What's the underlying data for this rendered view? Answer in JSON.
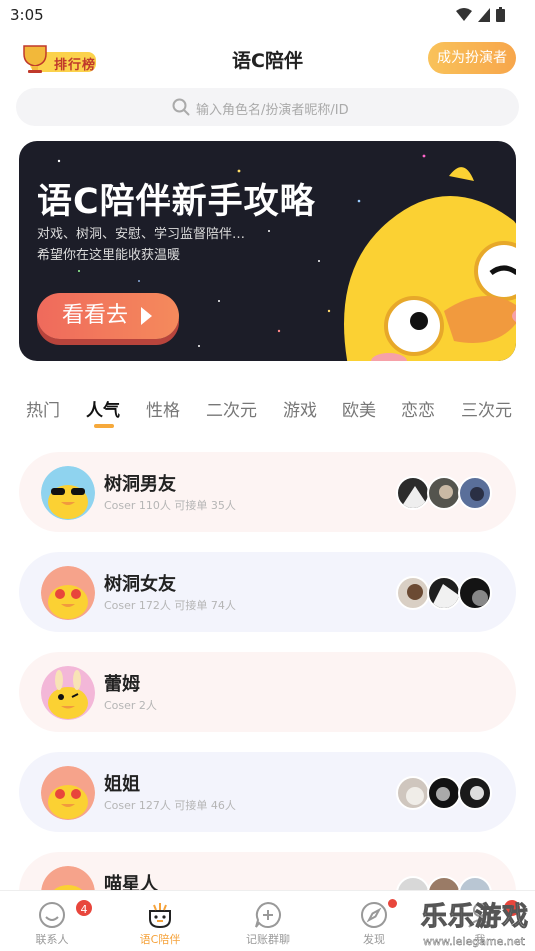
{
  "status_bar": {
    "time": "3:05"
  },
  "header": {
    "rank_label": "排行榜",
    "title": "语C陪伴",
    "become_button": "成为扮演者"
  },
  "search": {
    "placeholder": "输入角色名/扮演者昵称/ID"
  },
  "banner": {
    "title": "语C陪伴新手攻略",
    "subtitle_line1": "对戏、树洞、安慰、学习监督陪伴…",
    "subtitle_line2": "希望你在这里能收获温暖",
    "button_label": "看看去"
  },
  "tabs": [
    {
      "label": "热门"
    },
    {
      "label": "人气"
    },
    {
      "label": "性格"
    },
    {
      "label": "二次元"
    },
    {
      "label": "游戏"
    },
    {
      "label": "欧美"
    },
    {
      "label": "恋恋"
    },
    {
      "label": "三次元"
    }
  ],
  "active_tab": "人气",
  "cards": [
    {
      "title": "树洞男友",
      "meta": "Coser 110人  可接单 35人"
    },
    {
      "title": "树洞女友",
      "meta": "Coser 172人  可接单 74人"
    },
    {
      "title": "蕾姆",
      "meta": "Coser 2人"
    },
    {
      "title": "姐姐",
      "meta": "Coser 127人  可接单 46人"
    },
    {
      "title": "喵星人",
      "meta": ""
    }
  ],
  "bottom_nav": [
    {
      "label": "联系人",
      "icon": "smile-icon",
      "badge": "4"
    },
    {
      "label": "语C陪伴",
      "icon": "duck-icon",
      "badge": ""
    },
    {
      "label": "记账群聊",
      "icon": "chat-plus-icon",
      "badge": ""
    },
    {
      "label": "发现",
      "icon": "compass-icon",
      "badge": ""
    },
    {
      "label": "我",
      "icon": "person-icon",
      "badge": "1"
    }
  ],
  "watermark": {
    "text": "乐乐游戏",
    "url": "www.lelegame.net"
  },
  "colors": {
    "accent": "#f5a23a",
    "badge": "#e8463c",
    "card_pink": "#fdf4f3",
    "card_blue": "#f3f4fc"
  }
}
